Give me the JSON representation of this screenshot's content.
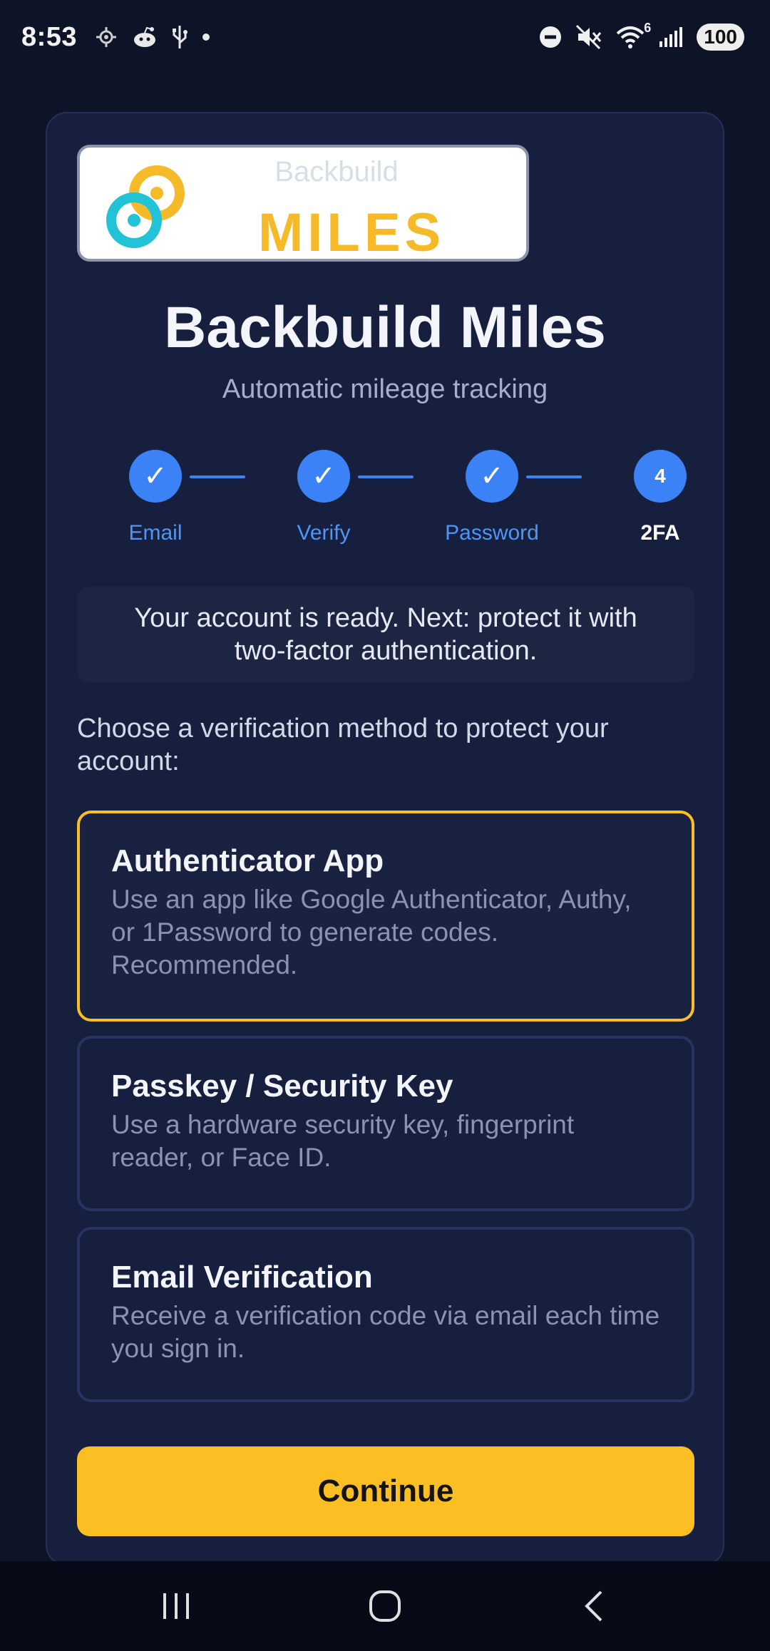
{
  "status_bar": {
    "time": "8:53",
    "left_icons": [
      "location-icon",
      "reddit-icon",
      "usb-icon",
      "dot-icon"
    ],
    "right_icons": [
      "dnd-icon",
      "mute-icon",
      "wifi-icon",
      "signal-icon"
    ],
    "wifi_badge": "6",
    "battery": "100"
  },
  "logo": {
    "faint_text": "Backbuild",
    "word": "MILES"
  },
  "app": {
    "title": "Backbuild Miles",
    "subtitle": "Automatic mileage tracking"
  },
  "stepper": {
    "steps": [
      {
        "label": "Email",
        "mark": "✓",
        "state": "done"
      },
      {
        "label": "Verify",
        "mark": "✓",
        "state": "done"
      },
      {
        "label": "Password",
        "mark": "✓",
        "state": "done"
      },
      {
        "label": "2FA",
        "mark": "4",
        "state": "current"
      }
    ]
  },
  "info": {
    "message": "Your account is ready. Next: protect it with two-factor authentication."
  },
  "instruction": "Choose a verification method to protect your account:",
  "options": [
    {
      "title": "Authenticator App",
      "description": "Use an app like Google Authenticator, Authy, or 1Password to generate codes. Recommended.",
      "selected": true
    },
    {
      "title": "Passkey / Security Key",
      "description": "Use a hardware security key, fingerprint reader, or Face ID.",
      "selected": false
    },
    {
      "title": "Email Verification",
      "description": "Receive a verification code via email each time you sign in.",
      "selected": false
    }
  ],
  "continue_label": "Continue",
  "nav": [
    "recents-icon",
    "home-icon",
    "back-icon"
  ],
  "colors": {
    "background": "#0d1428",
    "card": "#161f3e",
    "accent_yellow": "#fbbf24",
    "accent_blue": "#3b82f6",
    "logo_teal": "#22c3d6"
  }
}
